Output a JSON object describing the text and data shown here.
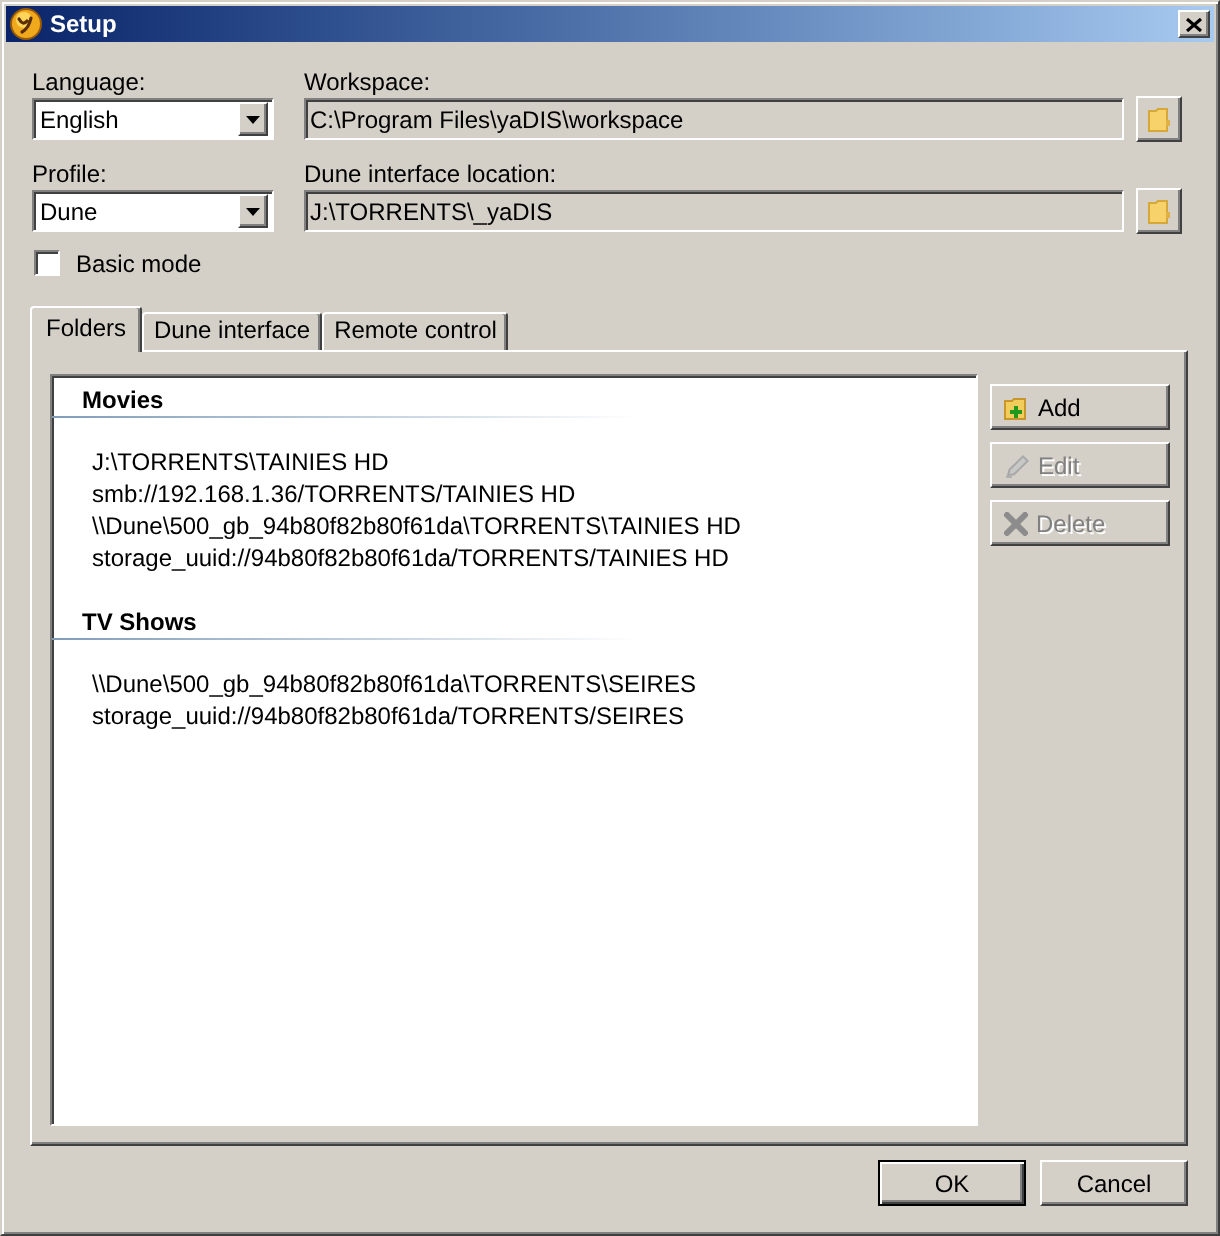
{
  "window": {
    "title": "Setup"
  },
  "language": {
    "label": "Language:",
    "value": "English"
  },
  "workspace": {
    "label": "Workspace:",
    "value": "C:\\Program Files\\yaDIS\\workspace"
  },
  "profile": {
    "label": "Profile:",
    "value": "Dune"
  },
  "dune_interface_location": {
    "label": "Dune interface location:",
    "value": "J:\\TORRENTS\\_yaDIS"
  },
  "basic_mode": {
    "label": "Basic mode",
    "checked": false
  },
  "tabs": [
    {
      "label": "Folders",
      "selected": true
    },
    {
      "label": "Dune interface",
      "selected": false
    },
    {
      "label": "Remote control",
      "selected": false
    }
  ],
  "folder_groups": [
    {
      "title": "Movies",
      "paths": [
        "J:\\TORRENTS\\TAINIES HD",
        "smb://192.168.1.36/TORRENTS/TAINIES HD",
        "\\\\Dune\\500_gb_94b80f82b80f61da\\TORRENTS\\TAINIES HD",
        "storage_uuid://94b80f82b80f61da/TORRENTS/TAINIES HD"
      ]
    },
    {
      "title": "TV Shows",
      "paths": [
        "\\\\Dune\\500_gb_94b80f82b80f61da\\TORRENTS\\SEIRES",
        "storage_uuid://94b80f82b80f61da/TORRENTS/SEIRES"
      ]
    }
  ],
  "side_buttons": [
    {
      "label": "Add",
      "kind": "add",
      "disabled": false
    },
    {
      "label": "Edit",
      "kind": "edit",
      "disabled": true
    },
    {
      "label": "Delete",
      "kind": "delete",
      "disabled": true
    }
  ],
  "dialog_buttons": [
    {
      "label": "OK",
      "default": true
    },
    {
      "label": "Cancel",
      "default": false
    }
  ]
}
